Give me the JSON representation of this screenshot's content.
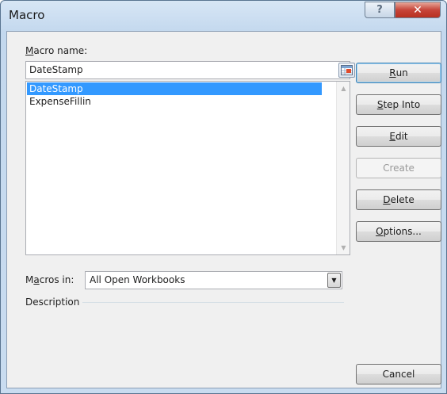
{
  "window": {
    "title": "Macro",
    "help_symbol": "?",
    "close_symbol": "✕"
  },
  "macro_name": {
    "label_mnemonic": "M",
    "label_rest": "acro name:",
    "value": "DateStamp"
  },
  "macro_list": {
    "items": [
      "DateStamp",
      "ExpenseFillin"
    ],
    "selected_index": 0
  },
  "buttons": {
    "run": {
      "mnemonic": "R",
      "rest": "un"
    },
    "step_into": {
      "mnemonic": "S",
      "rest": "tep Into"
    },
    "edit": {
      "mnemonic": "E",
      "rest": "dit"
    },
    "create": {
      "label": "Create",
      "enabled": false
    },
    "delete": {
      "mnemonic": "D",
      "rest": "elete"
    },
    "options": {
      "mnemonic": "O",
      "rest": "ptions..."
    },
    "cancel": {
      "label": "Cancel"
    }
  },
  "macros_in": {
    "label_pre": "M",
    "label_mnemonic": "a",
    "label_rest": "cros in:",
    "value": "All Open Workbooks"
  },
  "description": {
    "label": "Description"
  },
  "colors": {
    "selection": "#3399ff",
    "title_bar": "#c9dcf0",
    "close_button": "#c7453a"
  }
}
